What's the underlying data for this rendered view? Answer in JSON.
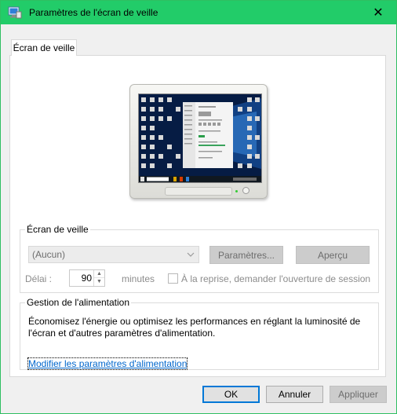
{
  "window": {
    "title": "Paramètres de l'écran de veille",
    "close_glyph": "✕"
  },
  "tab": {
    "label": "Écran de veille"
  },
  "screensaver": {
    "legend": "Écran de veille",
    "selected": "(Aucun)",
    "settings_label": "Paramètres...",
    "preview_label": "Aperçu",
    "delay_label": "Délai :",
    "delay_value": "90",
    "minutes_label": "minutes",
    "resume_label": "À la reprise, demander l'ouverture de session",
    "resume_checked": false
  },
  "power": {
    "legend": "Gestion de l'alimentation",
    "description": "Économisez l'énergie ou optimisez les performances en réglant la luminosité de l'écran et d'autres paramètres d'alimentation.",
    "link": "Modifier les paramètres d'alimentation"
  },
  "footer": {
    "ok_label": "OK",
    "cancel_label": "Annuler",
    "apply_label": "Appliquer"
  },
  "colors": {
    "titlebar": "#22cc69",
    "desktop": "#061c44",
    "link": "#0066cc",
    "focus": "#0078d7"
  },
  "icons": {
    "app": "screensaver-monitor-icon",
    "close": "close-icon",
    "combo_arrow": "chevron-down-icon",
    "spin_up": "spin-up-icon",
    "spin_down": "spin-down-icon"
  }
}
